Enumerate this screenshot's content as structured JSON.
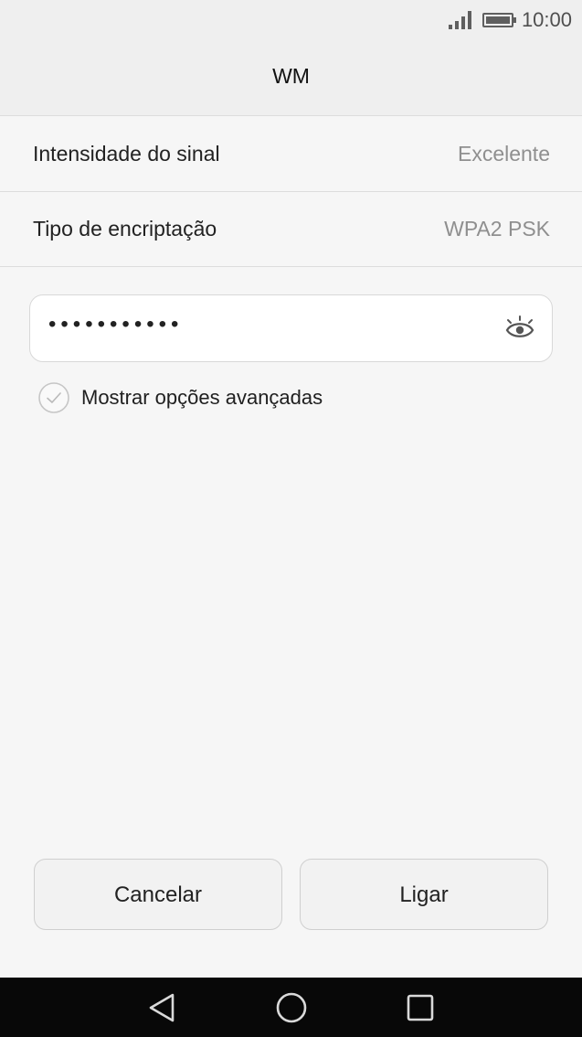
{
  "status_bar": {
    "time": "10:00",
    "icons": [
      "signal-bars-icon",
      "battery-icon"
    ]
  },
  "header": {
    "title": "WM"
  },
  "details": {
    "signal_label": "Intensidade do sinal",
    "signal_value": "Excelente",
    "encryption_label": "Tipo de encriptação",
    "encryption_value": "WPA2 PSK"
  },
  "password_field": {
    "value": "•••••••••••",
    "icon": "eye-icon"
  },
  "advanced_options": {
    "label": "Mostrar opções avançadas",
    "checked": false,
    "icon": "check-circle-icon"
  },
  "actions": {
    "cancel_label": "Cancelar",
    "connect_label": "Ligar"
  },
  "navigation": {
    "icons": [
      "back-icon",
      "home-icon",
      "recent-apps-icon"
    ]
  },
  "colors": {
    "header_background": "#efefef",
    "page_background": "#f6f6f6",
    "navigation_background": "#080808"
  }
}
